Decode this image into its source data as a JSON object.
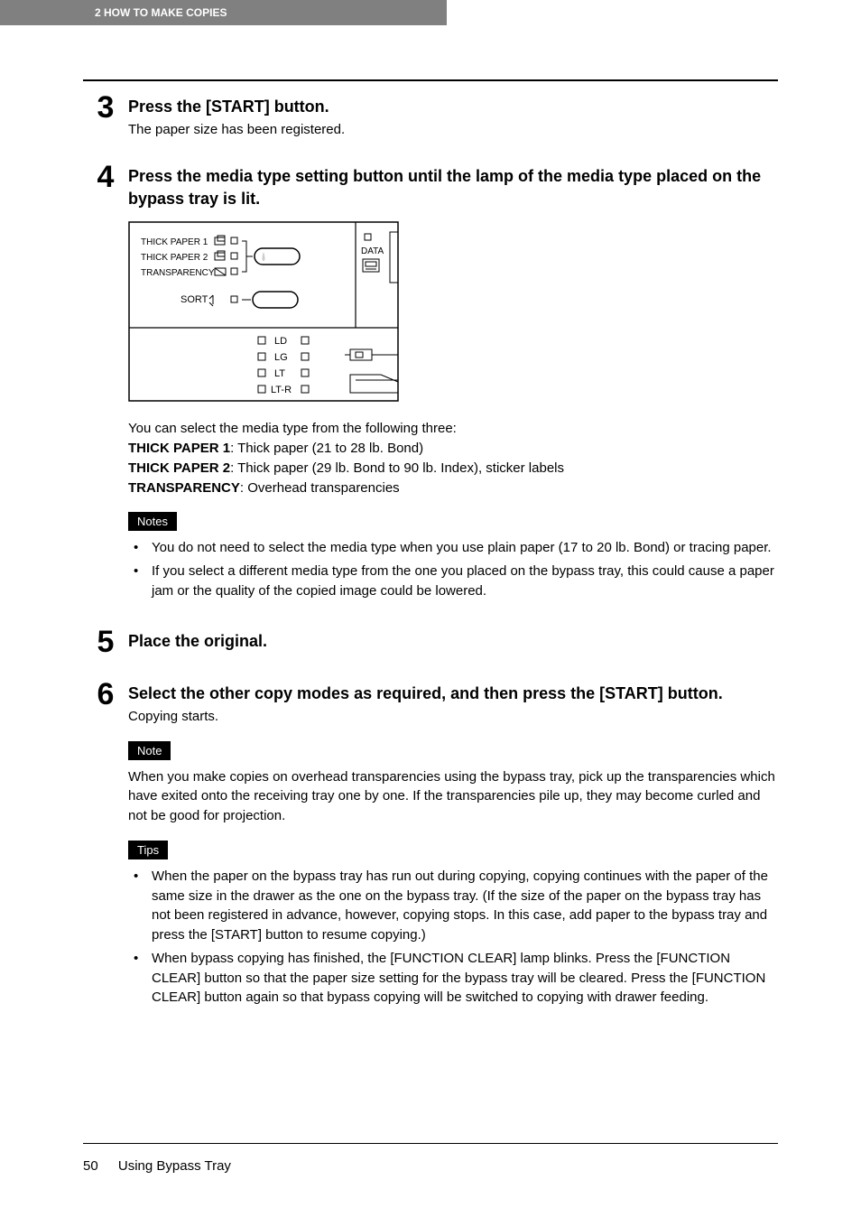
{
  "header": {
    "chapter_label": "2   HOW TO MAKE COPIES"
  },
  "steps": [
    {
      "num": "3",
      "title": "Press the [START] button.",
      "text": "The paper size has been registered."
    },
    {
      "num": "4",
      "title": "Press the media type setting button until the lamp of the media type placed on the bypass tray is lit.",
      "diagram": {
        "labels": {
          "thick1": "THICK PAPER 1",
          "thick2": "THICK PAPER 2",
          "transp": "TRANSPARENCY",
          "sort": "SORT",
          "data": "DATA",
          "ld": "LD",
          "lg": "LG",
          "lt": "LT",
          "ltr": "LT-R"
        }
      },
      "media_intro": "You can select the media type from the following three:",
      "media_types": [
        {
          "label": "THICK PAPER 1",
          "desc": ": Thick paper (21 to 28 lb. Bond)"
        },
        {
          "label": "THICK PAPER 2",
          "desc": ": Thick paper (29 lb. Bond to 90 lb. Index), sticker labels"
        },
        {
          "label": "TRANSPARENCY",
          "desc": ": Overhead transparencies"
        }
      ],
      "notes_tag": "Notes",
      "notes": [
        "You do not need to select the media type when you use plain paper (17 to 20 lb. Bond) or tracing paper.",
        "If you select a different media type from the one you placed on the bypass tray, this could cause a paper jam or the quality of the copied image could be lowered."
      ]
    },
    {
      "num": "5",
      "title": "Place the original."
    },
    {
      "num": "6",
      "title": "Select the other copy modes as required, and then press the [START] button.",
      "text": "Copying starts.",
      "note_tag": "Note",
      "note_text": "When you make copies on overhead transparencies using the bypass tray, pick up the transparencies which have exited onto the receiving tray one by one. If the transparencies pile up, they may become curled and not be good for projection.",
      "tips_tag": "Tips",
      "tips": [
        "When the paper on the bypass tray has run out during copying, copying continues with the paper of the same size in the drawer as the one on the bypass tray. (If the size of the paper on the bypass tray has not been registered in advance, however, copying stops. In this case, add paper to the bypass tray and press the [START] button to resume copying.)",
        "When bypass copying has finished, the [FUNCTION CLEAR] lamp blinks. Press the [FUNCTION CLEAR] button so that the paper size setting for the bypass tray will be cleared. Press the [FUNCTION CLEAR] button again so that bypass copying will be switched to copying with drawer feeding."
      ]
    }
  ],
  "footer": {
    "page": "50",
    "section": "Using Bypass Tray"
  }
}
